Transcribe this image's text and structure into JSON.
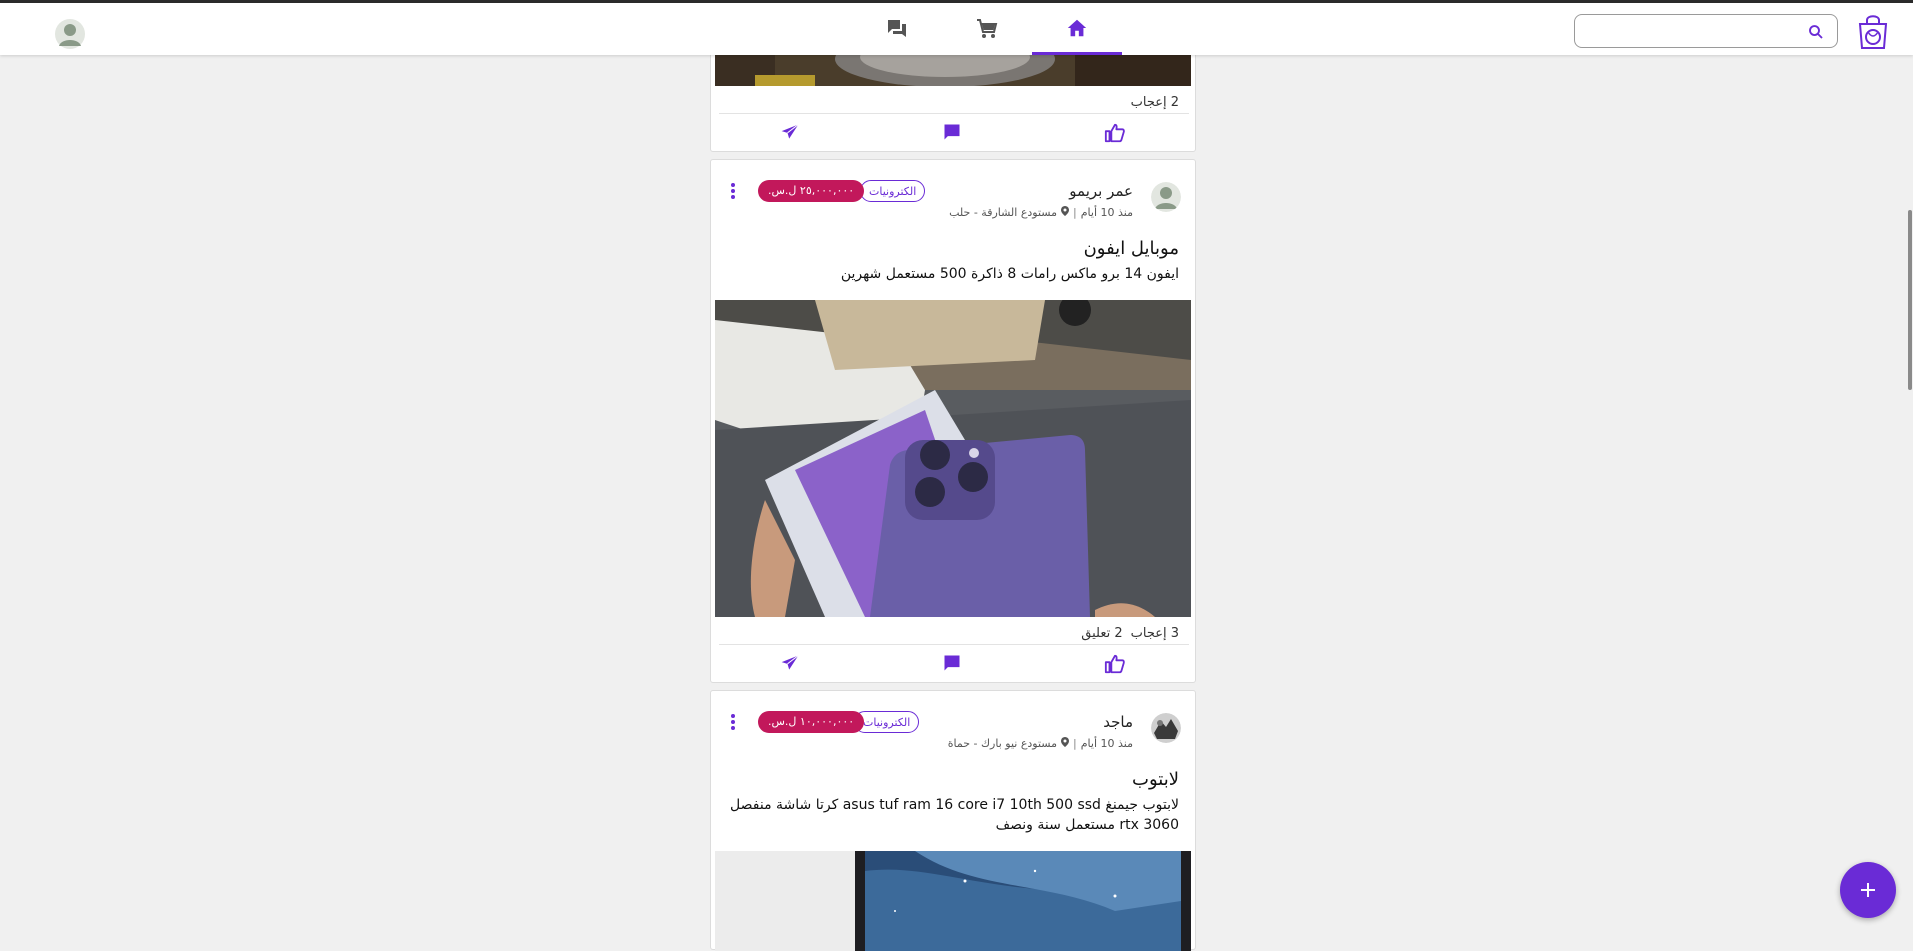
{
  "header": {
    "search": {
      "placeholder": "",
      "value": ""
    },
    "nav": [
      "messages-icon",
      "cart-icon",
      "home-icon"
    ],
    "active_nav": "home",
    "accent_color": "#6a2bd6"
  },
  "posts": [
    {
      "likes_text": "2 إعجاب",
      "comments_text": "",
      "actions": [
        "share-icon",
        "comment-icon",
        "like-icon"
      ]
    },
    {
      "user": "عمر بريمو",
      "time": "منذ 10 أيام",
      "location": "مستودع الشارقة - حلب",
      "category": "الكترونيات",
      "price": "٢٥,٠٠٠,٠٠٠ ل.س.",
      "title": "موبايل ايفون",
      "description": "ايفون 14 برو ماكس رامات 8 ذاكرة 500 مستعمل شهرين",
      "likes_text": "3 إعجاب",
      "comments_text": "2 تعليق"
    },
    {
      "user": "ماجد",
      "time": "منذ 10 أيام",
      "location": "مستودع نيو بارك - حماة",
      "category": "الكترونيات",
      "price": "١٠,٠٠٠,٠٠٠ ل.س.",
      "title": "لابتوب",
      "description": "لابتوب جيمنغ asus tuf ram 16 core i7 10th 500 ssd كرتا شاشة منفصل rtx 3060 مستعمل سنة ونصف"
    }
  ],
  "colors": {
    "price_badge": "#c2185b",
    "tag_border": "#6a2bd6"
  }
}
